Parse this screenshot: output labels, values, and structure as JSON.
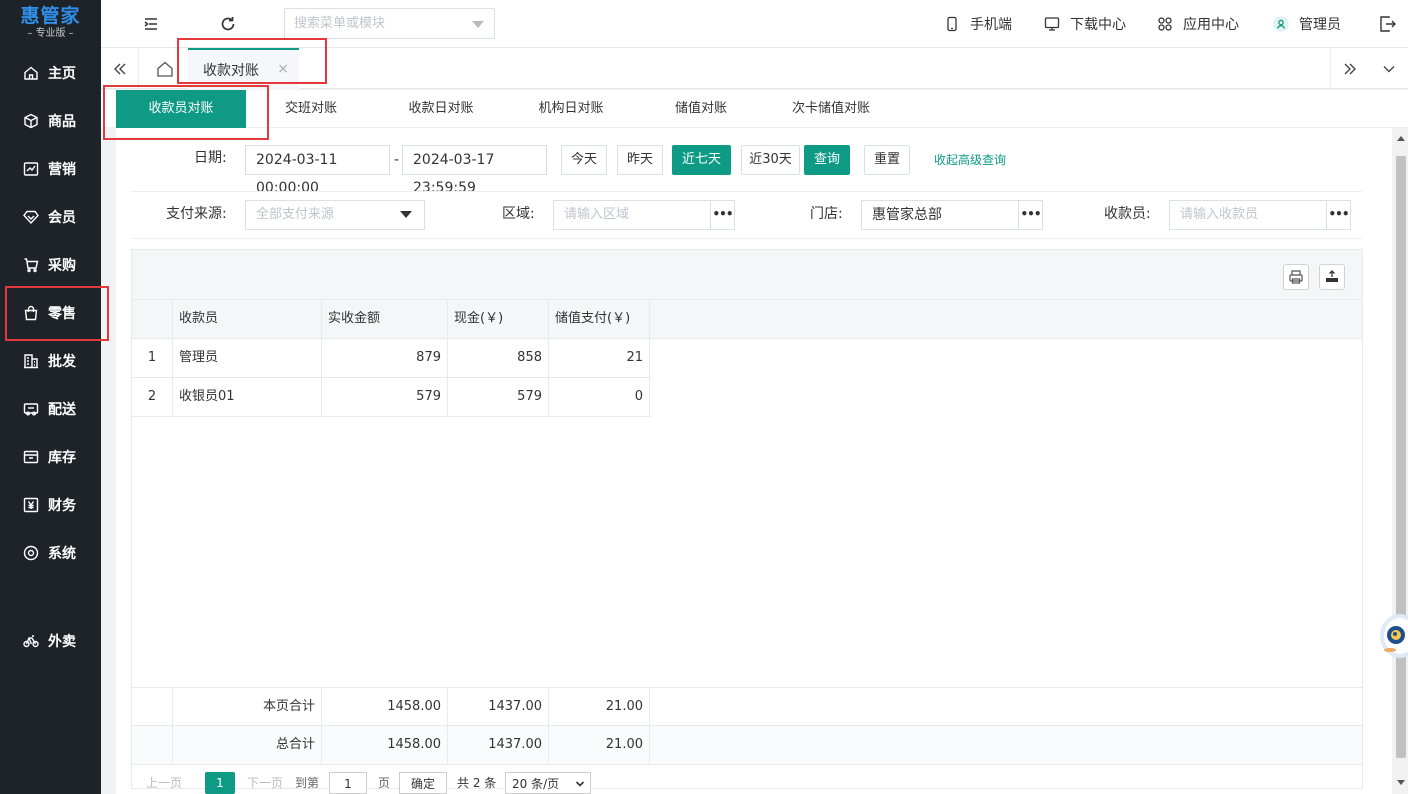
{
  "app": {
    "logo_main": "惠管家",
    "logo_sub": "– 专业版 –"
  },
  "sidebar": {
    "items": [
      {
        "label": "主页",
        "icon": "home-icon"
      },
      {
        "label": "商品",
        "icon": "box-icon"
      },
      {
        "label": "营销",
        "icon": "chart-icon"
      },
      {
        "label": "会员",
        "icon": "diamond-icon"
      },
      {
        "label": "采购",
        "icon": "cart-icon"
      },
      {
        "label": "零售",
        "icon": "bag-icon"
      },
      {
        "label": "批发",
        "icon": "building-icon"
      },
      {
        "label": "配送",
        "icon": "truck-icon"
      },
      {
        "label": "库存",
        "icon": "warehouse-icon"
      },
      {
        "label": "财务",
        "icon": "yen-icon"
      },
      {
        "label": "系统",
        "icon": "settings-icon"
      },
      {
        "label": "外卖",
        "icon": "bike-icon"
      }
    ]
  },
  "topbar": {
    "search_placeholder": "搜索菜单或模块",
    "mobile": "手机端",
    "download": "下载中心",
    "apps": "应用中心",
    "user": "管理员"
  },
  "tabs": {
    "open_tab": "收款对账",
    "close": "×"
  },
  "subtabs": [
    "收款员对账",
    "交班对账",
    "收款日对账",
    "机构日对账",
    "储值对账",
    "次卡储值对账"
  ],
  "filters": {
    "date_label": "日期:",
    "date_start": "2024-03-11 00:00:00",
    "date_dash": "-",
    "date_end": "2024-03-17 23:59:59",
    "btn_today": "今天",
    "btn_yesterday": "昨天",
    "btn_7days": "近七天",
    "btn_30days": "近30天",
    "btn_query": "查询",
    "btn_reset": "重置",
    "collapse_link": "收起高级查询",
    "pay_source_label": "支付来源:",
    "pay_source_value": "全部支付来源",
    "region_label": "区域:",
    "region_placeholder": "请输入区域",
    "store_label": "门店:",
    "store_value": "惠管家总部",
    "cashier_label": "收款员:",
    "cashier_placeholder": "请输入收款员",
    "dots": "•••"
  },
  "table": {
    "headers": [
      "收款员",
      "实收金额",
      "现金(￥)",
      "储值支付(￥)"
    ],
    "rows": [
      {
        "idx": "1",
        "name": "管理员",
        "received": "879",
        "cash": "858",
        "stored": "21"
      },
      {
        "idx": "2",
        "name": "收银员01",
        "received": "579",
        "cash": "579",
        "stored": "0"
      }
    ],
    "page_total": {
      "label": "本页合计",
      "received": "1458.00",
      "cash": "1437.00",
      "stored": "21.00"
    },
    "grand_total": {
      "label": "总合计",
      "received": "1458.00",
      "cash": "1437.00",
      "stored": "21.00"
    }
  },
  "pager": {
    "prev": "上一页",
    "current": "1",
    "next": "下一页",
    "goto": "到第",
    "goto_value": "1",
    "page_unit": "页",
    "confirm": "确定",
    "total": "共 2 条",
    "page_size": "20 条/页"
  }
}
